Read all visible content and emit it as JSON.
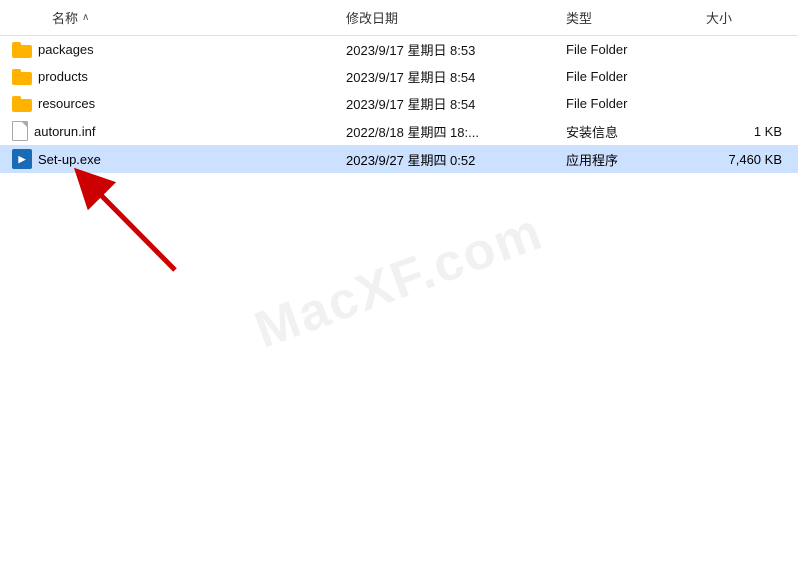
{
  "columns": {
    "name": "名称",
    "modified": "修改日期",
    "type": "类型",
    "size": "大小"
  },
  "files": [
    {
      "name": "packages",
      "modified": "2023/9/17 星期日 8:53",
      "type": "File Folder",
      "size": "",
      "icon": "folder"
    },
    {
      "name": "products",
      "modified": "2023/9/17 星期日 8:54",
      "type": "File Folder",
      "size": "",
      "icon": "folder"
    },
    {
      "name": "resources",
      "modified": "2023/9/17 星期日 8:54",
      "type": "File Folder",
      "size": "",
      "icon": "folder"
    },
    {
      "name": "autorun.inf",
      "modified": "2022/8/18 星期四 18:...",
      "type": "安装信息",
      "size": "1 KB",
      "icon": "file"
    },
    {
      "name": "Set-up.exe",
      "modified": "2023/9/27 星期四 0:52",
      "type": "应用程序",
      "size": "7,460 KB",
      "icon": "setup",
      "selected": true
    }
  ],
  "watermark": "MacXF.com",
  "watermark2": "XF.com"
}
